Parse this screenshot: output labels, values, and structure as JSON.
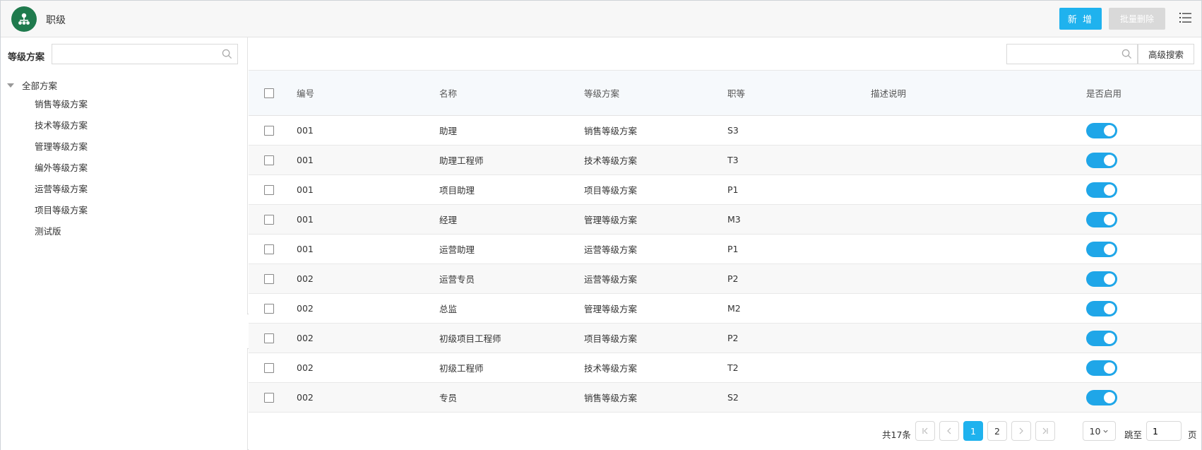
{
  "header": {
    "title": "职级",
    "add_label": "新 增",
    "batch_delete_label": "批量删除"
  },
  "colors": {
    "primary": "#1fb2ee",
    "logo_bg": "#1f7a4d",
    "toggle_on": "#1fa6e8"
  },
  "sidebar": {
    "label": "等级方案",
    "search_value": "",
    "root": "全部方案",
    "items": [
      "销售等级方案",
      "技术等级方案",
      "管理等级方案",
      "编外等级方案",
      "运营等级方案",
      "项目等级方案",
      "测试版"
    ]
  },
  "toolbar": {
    "search_value": "",
    "advanced_label": "高级搜索"
  },
  "table": {
    "columns": {
      "code": "编号",
      "name": "名称",
      "plan": "等级方案",
      "grade": "职等",
      "desc": "描述说明",
      "enabled": "是否启用"
    },
    "rows": [
      {
        "code": "001",
        "name": "助理",
        "plan": "销售等级方案",
        "grade": "S3",
        "desc": "",
        "enabled": true
      },
      {
        "code": "001",
        "name": "助理工程师",
        "plan": "技术等级方案",
        "grade": "T3",
        "desc": "",
        "enabled": true
      },
      {
        "code": "001",
        "name": "项目助理",
        "plan": "项目等级方案",
        "grade": "P1",
        "desc": "",
        "enabled": true
      },
      {
        "code": "001",
        "name": "经理",
        "plan": "管理等级方案",
        "grade": "M3",
        "desc": "",
        "enabled": true
      },
      {
        "code": "001",
        "name": "运营助理",
        "plan": "运营等级方案",
        "grade": "P1",
        "desc": "",
        "enabled": true
      },
      {
        "code": "002",
        "name": "运营专员",
        "plan": "运营等级方案",
        "grade": "P2",
        "desc": "",
        "enabled": true
      },
      {
        "code": "002",
        "name": "总监",
        "plan": "管理等级方案",
        "grade": "M2",
        "desc": "",
        "enabled": true
      },
      {
        "code": "002",
        "name": "初级项目工程师",
        "plan": "项目等级方案",
        "grade": "P2",
        "desc": "",
        "enabled": true
      },
      {
        "code": "002",
        "name": "初级工程师",
        "plan": "技术等级方案",
        "grade": "T2",
        "desc": "",
        "enabled": true
      },
      {
        "code": "002",
        "name": "专员",
        "plan": "销售等级方案",
        "grade": "S2",
        "desc": "",
        "enabled": true
      }
    ]
  },
  "pagination": {
    "total_label": "共17条",
    "pages": [
      "1",
      "2"
    ],
    "current": "1",
    "page_size": "10",
    "jump_label": "跳至",
    "jump_value": "1",
    "page_unit": "页",
    "icons": [
      "first-page-icon",
      "prev-page-icon",
      "next-page-icon",
      "last-page-icon"
    ]
  }
}
